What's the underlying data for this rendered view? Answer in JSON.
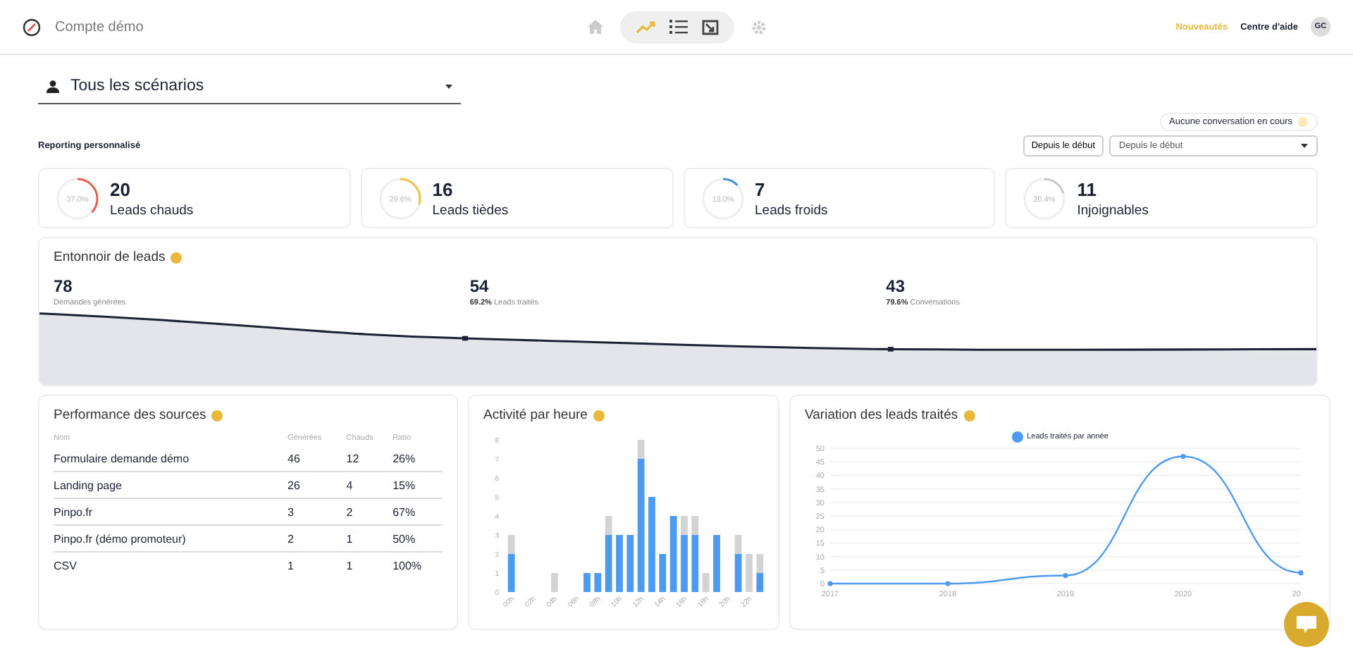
{
  "topbar": {
    "account": "Compte démo",
    "views": [
      {
        "kind": "chart",
        "selected": true
      },
      {
        "kind": "list",
        "selected": false
      },
      {
        "kind": "export",
        "selected": false
      }
    ],
    "links": [
      {
        "label": "Nouveautés",
        "highlighted": true
      },
      {
        "label": "Centre d'aide",
        "highlighted": false
      }
    ],
    "avatar": "GC"
  },
  "scenario": {
    "label": "Tous les scénarios"
  },
  "status_badge": "Aucune conversation en cours",
  "report": {
    "title": "Reporting personnalisé",
    "period_button": "Depuis le début",
    "period_select": "Depuis le début"
  },
  "stats": [
    {
      "value": "20",
      "label": "Leads chauds",
      "percent": "37.0%",
      "level": 0.37,
      "color": "#e8604c"
    },
    {
      "value": "16",
      "label": "Leads tièdes",
      "percent": "29.6%",
      "level": 0.296,
      "color": "#f2c23a"
    },
    {
      "value": "7",
      "label": "Leads froids",
      "percent": "13.0%",
      "level": 0.13,
      "color": "#4a90e2"
    },
    {
      "value": "11",
      "label": "Injoignables",
      "percent": "20.4%",
      "level": 0.204,
      "color": "#c8c8c8"
    }
  ],
  "funnel": {
    "title": "Entonnoir de leads",
    "steps": [
      {
        "value": "78",
        "label": "Demandes générées"
      },
      {
        "value": "54",
        "rate": "69.2%",
        "label": "Leads traités"
      },
      {
        "value": "43",
        "rate": "79.6%",
        "label": "Conversations"
      }
    ]
  },
  "sources": {
    "title": "Performance des sources",
    "columns": [
      "Nom",
      "Générées",
      "Chauds",
      "Ratio"
    ],
    "rows": [
      [
        "Formulaire demande démo",
        "46",
        "12",
        "26%"
      ],
      [
        "Landing page",
        "26",
        "4",
        "15%"
      ],
      [
        "Pinpo.fr",
        "3",
        "2",
        "67%"
      ],
      [
        "Pinpo.fr (démo promoteur)",
        "2",
        "1",
        "50%"
      ],
      [
        "CSV",
        "1",
        "1",
        "100%"
      ]
    ]
  },
  "activity": {
    "title": "Activité par heure",
    "chart_data": {
      "type": "bar",
      "stacked": true,
      "x": [
        0,
        1,
        2,
        3,
        4,
        5,
        6,
        7,
        8,
        9,
        10,
        11,
        12,
        13,
        14,
        15,
        16,
        17,
        18,
        19,
        20,
        21,
        22,
        23
      ],
      "series": [
        {
          "color": "#4e9af1",
          "values": [
            2,
            0,
            0,
            0,
            0,
            0,
            0,
            1,
            1,
            3,
            3,
            3,
            7,
            5,
            2,
            4,
            3,
            3,
            0,
            3,
            0,
            2,
            0,
            1
          ]
        },
        {
          "color": "#d3d3d3",
          "values": [
            1,
            0,
            0,
            0,
            1,
            0,
            0,
            0,
            0,
            1,
            0,
            0,
            1,
            0,
            0,
            0,
            1,
            1,
            1,
            0,
            0,
            1,
            2,
            1
          ]
        }
      ],
      "xlim": [
        -0.5,
        23.5
      ],
      "ylim": [
        0,
        8
      ],
      "yticks": [
        0,
        1,
        2,
        3,
        4,
        5,
        6,
        7,
        8
      ],
      "xticks": [
        {
          "value": 0,
          "label": "00h"
        },
        {
          "value": 2,
          "label": "02h"
        },
        {
          "value": 4,
          "label": "04h"
        },
        {
          "value": 6,
          "label": "06h"
        },
        {
          "value": 8,
          "label": "08h"
        },
        {
          "value": 10,
          "label": "10h"
        },
        {
          "value": 12,
          "label": "12h"
        },
        {
          "value": 14,
          "label": "14h"
        },
        {
          "value": 16,
          "label": "16h"
        },
        {
          "value": 18,
          "label": "18h"
        },
        {
          "value": 20,
          "label": "20h"
        },
        {
          "value": 22,
          "label": "22h"
        }
      ]
    }
  },
  "variation": {
    "title": "Variation des leads traités",
    "chart_data": {
      "type": "line",
      "categories": [
        "2017",
        "2018",
        "2019",
        "2020",
        "20"
      ],
      "series": [
        {
          "name": "Leads traités par année",
          "color": "#4e9af1",
          "marker": "circle",
          "values": [
            0,
            0,
            3,
            47,
            4
          ]
        }
      ],
      "ylim": [
        0,
        50
      ],
      "yticks": [
        0,
        5,
        10,
        15,
        20,
        25,
        30,
        35,
        40,
        45,
        50
      ],
      "grid": true
    }
  }
}
